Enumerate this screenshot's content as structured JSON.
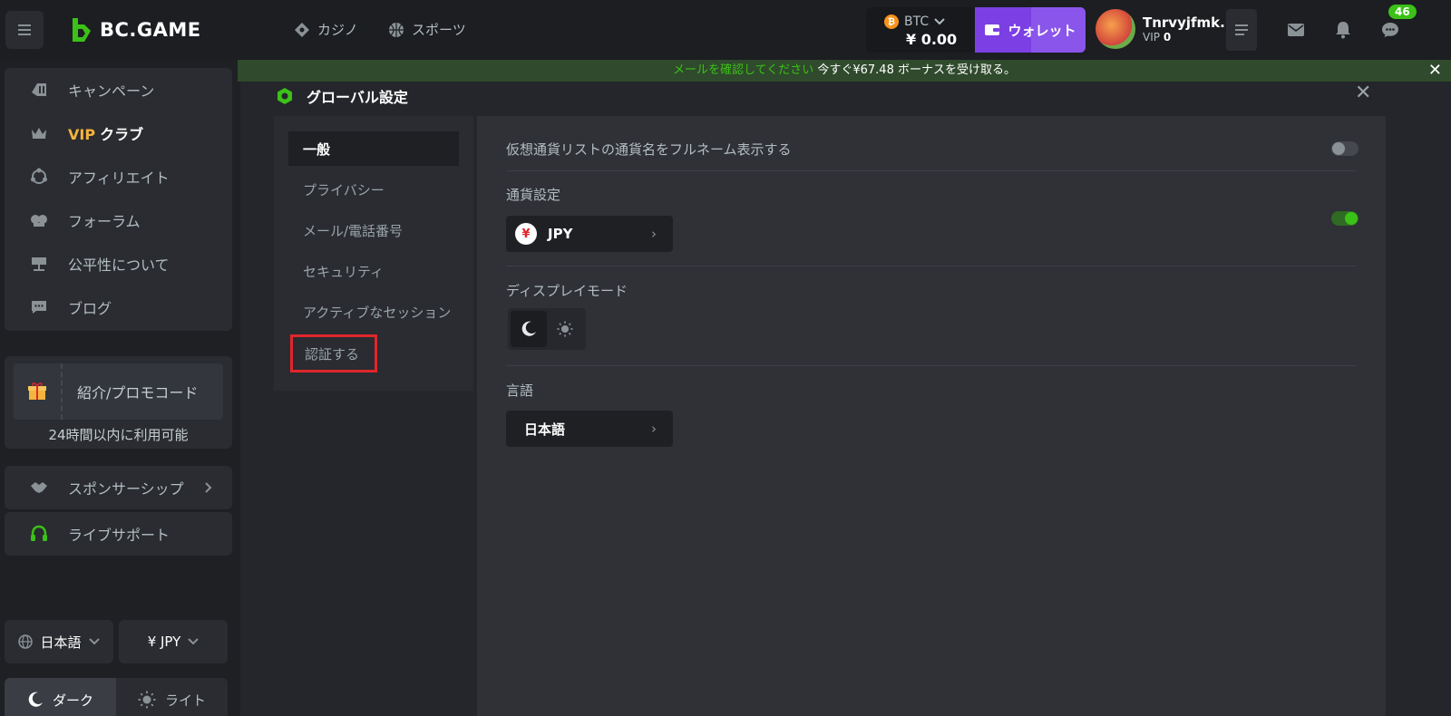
{
  "header": {
    "logo_text": "BC.GAME",
    "nav": [
      {
        "label": "カジノ",
        "icon": "casino-icon"
      },
      {
        "label": "スポーツ",
        "icon": "sports-icon"
      }
    ],
    "balance": {
      "currency": "BTC",
      "amount": "¥ 0.00"
    },
    "wallet_label": "ウォレット",
    "user": {
      "name": "Tnrvyjfmk...",
      "vip_label": "VIP",
      "vip_level": "0"
    },
    "chat_badge": "46"
  },
  "sidebar": {
    "items": [
      {
        "label": "キャンペーン",
        "icon": "campaign-icon"
      },
      {
        "vip": "VIP",
        "label": "クラブ",
        "icon": "crown-icon"
      },
      {
        "label": "アフィリエイト",
        "icon": "affiliate-icon"
      },
      {
        "label": "フォーラム",
        "icon": "forum-icon"
      },
      {
        "label": "公平性について",
        "icon": "fairness-icon"
      },
      {
        "label": "ブログ",
        "icon": "blog-icon"
      }
    ],
    "promo_label": "紹介/プロモコード",
    "promo_sub": "24時間以内に利用可能",
    "sponsorship": "スポンサーシップ",
    "support": "ライブサポート",
    "language": "日本語",
    "currency": "¥ JPY",
    "theme_dark": "ダーク",
    "theme_light": "ライト"
  },
  "banner": {
    "link_text": "メールを確認してください",
    "text": " 今すぐ¥67.48 ボーナスを受け取る。"
  },
  "settings": {
    "title": "グローバル設定",
    "tabs": [
      "一般",
      "プライバシー",
      "メール/電話番号",
      "セキュリティ",
      "アクティブなセッション",
      "認証する"
    ],
    "active_tab": "一般",
    "highlighted_tab": "認証する",
    "full_name_label": "仮想通貨リストの通貨名をフルネーム表示する",
    "full_name_enabled": false,
    "currency_label": "通貨設定",
    "currency_value": "JPY",
    "currency_toggle_enabled": true,
    "display_mode_label": "ディスプレイモード",
    "display_mode": "dark",
    "language_label": "言語",
    "language_value": "日本語"
  },
  "colors": {
    "accent_green": "#3bc117",
    "wallet_purple": "#7b3fe4",
    "vip_gold": "#f5b43c",
    "highlight_red": "#e0262a"
  }
}
